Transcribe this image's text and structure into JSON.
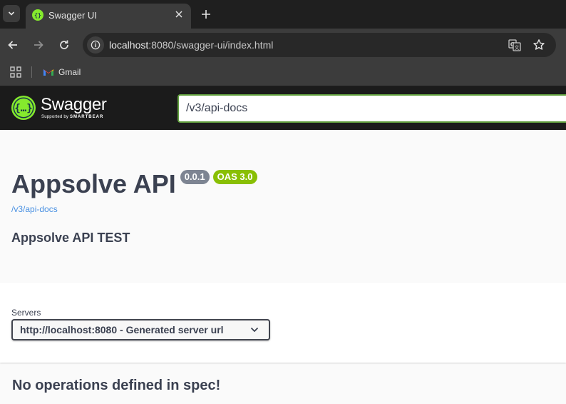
{
  "browser": {
    "tab": {
      "title": "Swagger UI",
      "favicon": "swagger-favicon"
    },
    "address_bar": {
      "host": "localhost",
      "path": ":8080/swagger-ui/index.html"
    },
    "bookmarks": [
      {
        "label": "Gmail",
        "icon": "gmail-icon"
      }
    ],
    "colors": {
      "tabstrip": "#1f1f1f",
      "toolbar": "#3c3c3c",
      "omnibox": "#282828"
    }
  },
  "swagger": {
    "logo": {
      "name": "Swagger",
      "supported_by": "Supported by",
      "brand": "SMARTBEAR"
    },
    "spec_url": "/v3/api-docs",
    "info": {
      "title": "Appsolve API",
      "version": "0.0.1",
      "oas": "OAS 3.0",
      "spec_link": "/v3/api-docs",
      "description": "Appsolve API TEST"
    },
    "servers": {
      "label": "Servers",
      "selected": "http://localhost:8080 - Generated server url"
    },
    "operations_message": "No operations defined in spec!",
    "colors": {
      "topbar": "#1b1b1b",
      "accent": "#62a03f",
      "version_badge": "#7d8492",
      "oas_badge": "#89bf04",
      "link": "#4990e2",
      "text": "#3b4151"
    }
  }
}
